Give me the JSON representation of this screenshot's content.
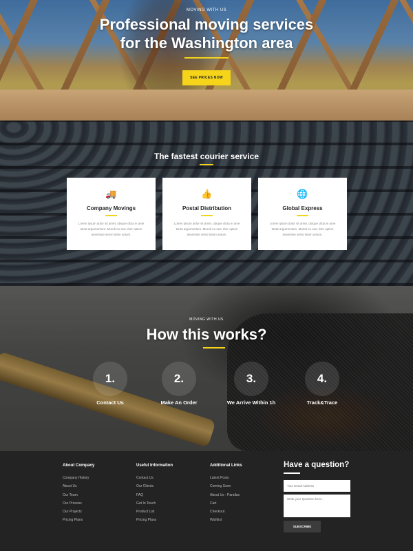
{
  "hero": {
    "eyebrow": "MOVING WITH US",
    "title_line1": "Professional moving services",
    "title_line2": "for the Washington area",
    "cta_label": "SEE PRICES NOW"
  },
  "services": {
    "title": "The fastest courier service",
    "cards": [
      {
        "icon": "truck-icon",
        "glyph": "🚚",
        "title": "Company Movings",
        "text": "Lorem ipsum dolor sit amet, ubique dicta in ame tanta argumentum. Mundi eu sea. Iber option assentiue sensi tation anium."
      },
      {
        "icon": "thumbs-up-icon",
        "glyph": "👍",
        "title": "Postal Distribution",
        "text": "Lorem ipsum dolor sit amet, ubique dicta in ame tanta argumentum. Mundi eu sea. Iber option assentiue sensi tation anium."
      },
      {
        "icon": "globe-icon",
        "glyph": "🌐",
        "title": "Global Express",
        "text": "Lorem ipsum dolor sit amet, ubique dicta in ame tanta argumentum. Mundi eu sea. Iber option assentiue sensi tation anium."
      }
    ]
  },
  "how": {
    "eyebrow": "MOVING WITH US",
    "title": "How this works?",
    "steps": [
      {
        "number": "1.",
        "label": "Contact Us"
      },
      {
        "number": "2.",
        "label": "Make An Order"
      },
      {
        "number": "3.",
        "label": "We Arrive Within 1h"
      },
      {
        "number": "4.",
        "label": "Track&Trace"
      }
    ]
  },
  "footer": {
    "columns": [
      {
        "heading": "About Company",
        "links": [
          "Company History",
          "About Us",
          "Our Team",
          "Our Process",
          "Our Projects",
          "Pricing Plans"
        ]
      },
      {
        "heading": "Useful Information",
        "links": [
          "Contact Us",
          "Our Clients",
          "FAQ",
          "Get In Touch",
          "Product List",
          "Pricing Plans"
        ]
      },
      {
        "heading": "Additional Links",
        "links": [
          "Latest Posts",
          "Coming Soon",
          "About Us - Parallax",
          "Cart",
          "Checkout",
          "Wishlist"
        ]
      }
    ],
    "question": {
      "heading": "Have a question?",
      "email_placeholder": "Your Email Address",
      "question_placeholder": "Write your Question here...",
      "submit_label": "SUBSCRIBE"
    }
  },
  "colors": {
    "accent": "#f5d41a",
    "footer_bg": "#232323",
    "card_bg": "#ffffff"
  }
}
